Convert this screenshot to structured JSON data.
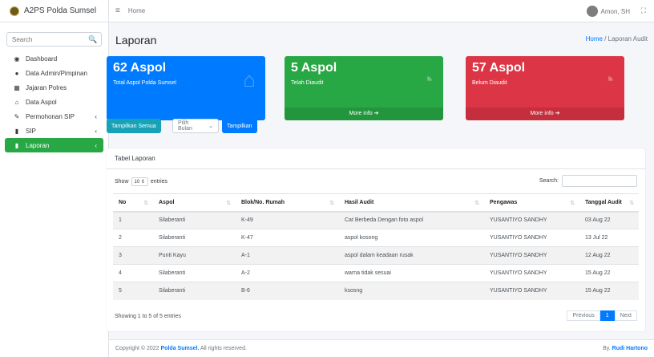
{
  "sidebar": {
    "brand": "A2PS Polda Sumsel",
    "search_placeholder": "Search",
    "items": [
      {
        "label": "Dashboard",
        "icon": "dashboard-icon",
        "glyph": "◉"
      },
      {
        "label": "Data Admin/Pimpinan",
        "icon": "user-icon",
        "glyph": "●"
      },
      {
        "label": "Jajaran Polres",
        "icon": "grid-icon",
        "glyph": "▦"
      },
      {
        "label": "Data Aspol",
        "icon": "home-icon",
        "glyph": "⌂"
      },
      {
        "label": "Permohonan SIP",
        "icon": "edit-icon",
        "glyph": "✎",
        "chevron": "‹"
      },
      {
        "label": "SIP",
        "icon": "file-icon",
        "glyph": "▮",
        "chevron": "‹"
      },
      {
        "label": "Laporan",
        "icon": "file-icon",
        "glyph": "▮",
        "chevron": "‹",
        "active": true
      }
    ]
  },
  "topbar": {
    "home": "Home",
    "user": "Amon, SH",
    "menu_icon": "≡",
    "expand_icon": "⛶"
  },
  "page": {
    "title": "Laporan",
    "crumb_home": "Home",
    "crumb_sep": " / ",
    "crumb_current": "Laporan Audit"
  },
  "boxes": [
    {
      "num": "62 Aspol",
      "label": "Total Aspol Polda Sumsel",
      "icon": "home-icon",
      "glyph": "⌂",
      "color": "#007bff"
    },
    {
      "num": "5 Aspol",
      "label": "Telah Diaudit",
      "icon": "pie-chart-icon",
      "glyph": "◔",
      "footer": "More info ➔",
      "color": "#28a745"
    },
    {
      "num": "57 Aspol",
      "label": "Belum Diaudit",
      "icon": "pie-chart-icon",
      "glyph": "◔",
      "footer": "More info ➔",
      "color": "#dc3545"
    }
  ],
  "controls": {
    "show_all": "Tampilkan Semua",
    "select_month": "Pilih Bulan",
    "show": "Tampilkan"
  },
  "table_card": {
    "title": "Tabel Laporan",
    "show_label": "Show",
    "entries_value": "10",
    "entries_label": "entries",
    "search_label": "Search:",
    "columns": [
      "No",
      "Aspol",
      "Blok/No. Rumah",
      "Hasil Audit",
      "Pengawas",
      "Tanggal Audit"
    ],
    "rows": [
      [
        "1",
        "Silaberanti",
        "K-49",
        "Cat Berbeda Dengan foto aspol",
        "YUSANTIYO SANDHY",
        "03 Aug 22"
      ],
      [
        "2",
        "Silaberanti",
        "K-47",
        "aspol kosong",
        "YUSANTIYO SANDHY",
        "13 Jul 22"
      ],
      [
        "3",
        "Punti Kayu",
        "A-1",
        "aspol dalam keadaan rusak",
        "YUSANTIYO SANDHY",
        "12 Aug 22"
      ],
      [
        "4",
        "Silaberanti",
        "A-2",
        "warna tidak sesuai",
        "YUSANTIYO SANDHY",
        "15 Aug 22"
      ],
      [
        "5",
        "Silaberanti",
        "B-6",
        "ksosng",
        "YUSANTIYO SANDHY",
        "15 Aug 22"
      ]
    ],
    "info": "Showing 1 to 5 of 5 entries",
    "prev": "Previous",
    "page": "1",
    "next": "Next"
  },
  "footer": {
    "copyright": "Copyright © 2022 ",
    "org": "Polda Sumsel.",
    "rights": " All rights reserved.",
    "by": "By. ",
    "author": "Rudi Hartono"
  }
}
